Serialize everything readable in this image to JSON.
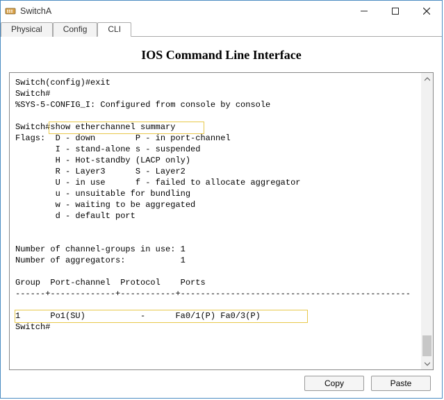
{
  "window": {
    "title": "SwitchA"
  },
  "tabs": {
    "physical": "Physical",
    "config": "Config",
    "cli": "CLI"
  },
  "cli": {
    "heading": "IOS Command Line Interface",
    "lines": [
      "Switch(config)#exit",
      "Switch#",
      "%SYS-5-CONFIG_I: Configured from console by console",
      "",
      "Switch#show etherchannel summary",
      "Flags:  D - down        P - in port-channel",
      "        I - stand-alone s - suspended",
      "        H - Hot-standby (LACP only)",
      "        R - Layer3      S - Layer2",
      "        U - in use      f - failed to allocate aggregator",
      "        u - unsuitable for bundling",
      "        w - waiting to be aggregated",
      "        d - default port",
      "",
      "",
      "Number of channel-groups in use: 1",
      "Number of aggregators:           1",
      "",
      "Group  Port-channel  Protocol    Ports",
      "------+-------------+-----------+----------------------------------------------",
      "",
      "1      Po1(SU)           -      Fa0/1(P) Fa0/3(P)",
      "Switch#"
    ]
  },
  "buttons": {
    "copy": "Copy",
    "paste": "Paste"
  }
}
